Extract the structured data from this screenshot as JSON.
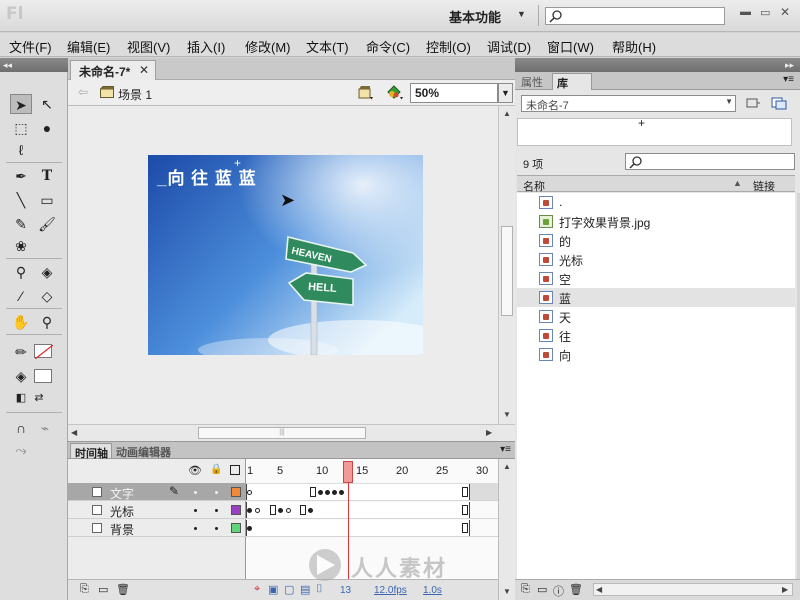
{
  "app": {
    "logo": "Fl",
    "workspace": "基本功能"
  },
  "menu": [
    "文件(F)",
    "编辑(E)",
    "视图(V)",
    "插入(I)",
    "修改(M)",
    "文本(T)",
    "命令(C)",
    "控制(O)",
    "调试(D)",
    "窗口(W)",
    "帮助(H)"
  ],
  "document": {
    "tab_label": "未命名-7*",
    "scene_label": "场景 1",
    "zoom": "50%"
  },
  "stage": {
    "overlay_text": "_向 往 蓝 蓝",
    "sign_top": "HEAVEN",
    "sign_bottom": "HELL"
  },
  "timeline": {
    "tabs": [
      "时间轴",
      "动画编辑器"
    ],
    "frame_numbers": [
      "1",
      "5",
      "10",
      "15",
      "20",
      "25",
      "30"
    ],
    "layers": [
      {
        "name": "文字",
        "color": "#f08a3a",
        "selected": true
      },
      {
        "name": "光标",
        "color": "#9b3fc2",
        "selected": false
      },
      {
        "name": "背景",
        "color": "#5fd67a",
        "selected": false
      }
    ],
    "current_frame": "13",
    "fps": "12.0fps",
    "time": "1.0s"
  },
  "right_panel": {
    "tabs": [
      "属性",
      "库"
    ],
    "library_doc": "未命名-7",
    "item_count": "9 项",
    "column_name": "名称",
    "column_link": "链接",
    "items": [
      {
        "label": ".",
        "kind": "graphic"
      },
      {
        "label": "打字效果背景.jpg",
        "kind": "bitmap"
      },
      {
        "label": "的",
        "kind": "graphic"
      },
      {
        "label": "光标",
        "kind": "graphic"
      },
      {
        "label": "空",
        "kind": "graphic"
      },
      {
        "label": "蓝",
        "kind": "graphic"
      },
      {
        "label": "天",
        "kind": "graphic"
      },
      {
        "label": "往",
        "kind": "graphic"
      },
      {
        "label": "向",
        "kind": "graphic"
      }
    ]
  },
  "watermark": "人人素材"
}
